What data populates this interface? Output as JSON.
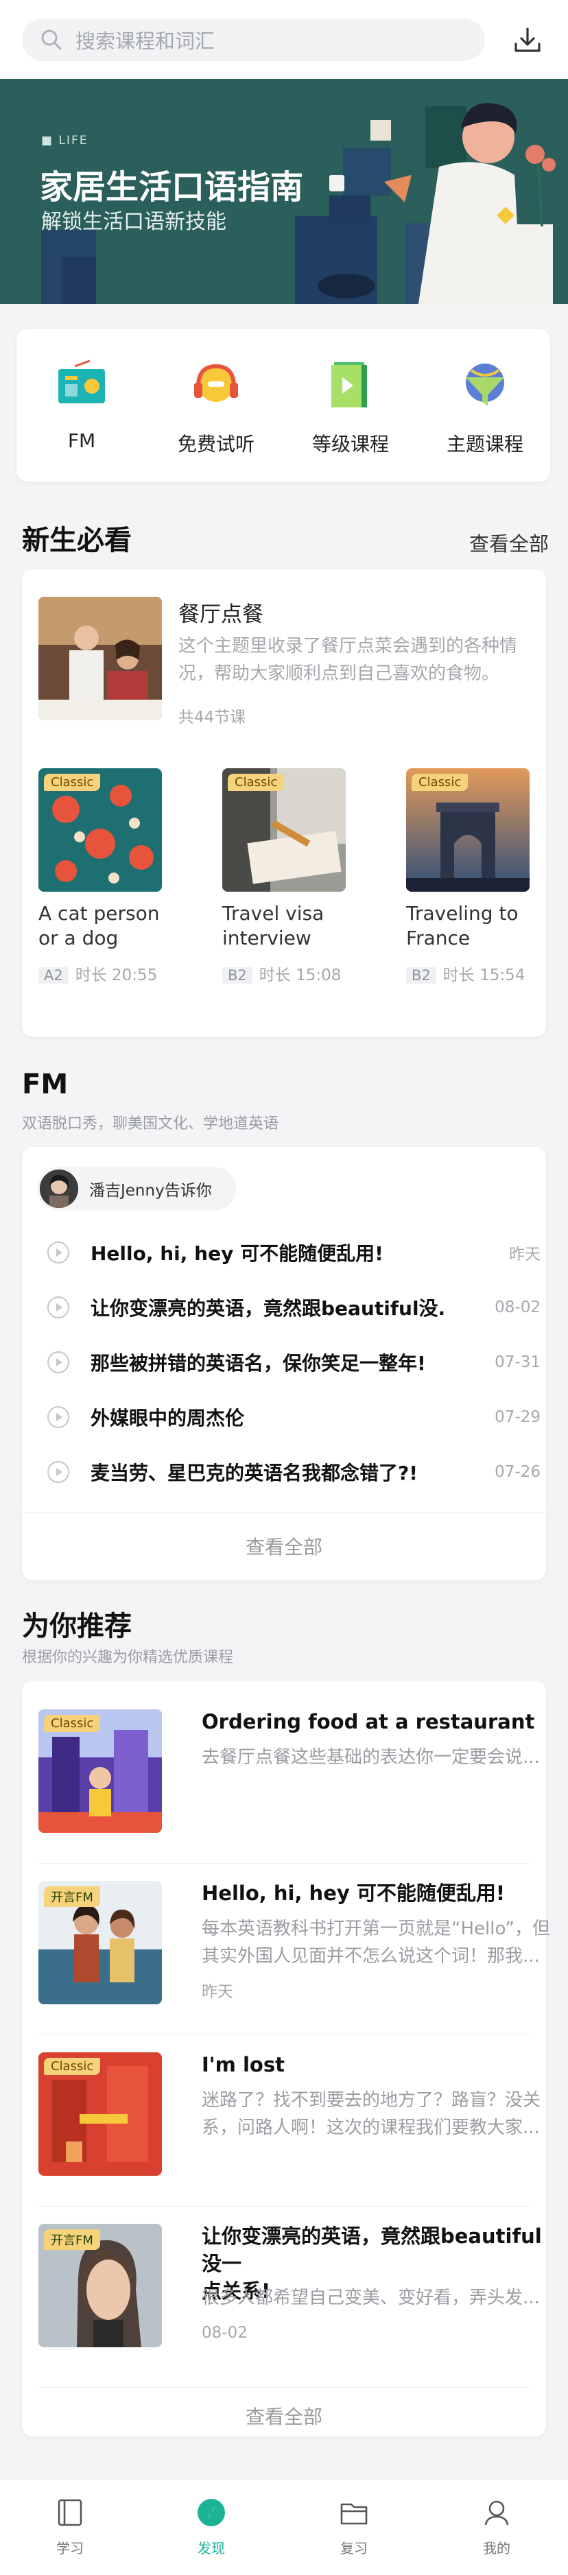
{
  "search": {
    "placeholder": "搜索课程和词汇"
  },
  "banner": {
    "label": "LIFE",
    "title": "家居生活口语指南",
    "subtitle": "解锁生活口语新技能",
    "slide_count": 3,
    "active_slide": 3
  },
  "quick": [
    {
      "label": "FM",
      "icon": "radio-icon"
    },
    {
      "label": "免费试听",
      "icon": "headphones-icon"
    },
    {
      "label": "等级课程",
      "icon": "play-book-icon"
    },
    {
      "label": "主题课程",
      "icon": "globe-funnel-icon"
    }
  ],
  "newbie": {
    "title": "新生必看",
    "more": "查看全部",
    "featured": {
      "title": "餐厅点餐",
      "desc": "这个主题里收录了餐厅点菜会遇到的各种情况，帮助大家顺利点到自己喜欢的食物。",
      "count": "共44节课"
    },
    "courses": [
      {
        "tag": "Classic",
        "title_line1": "A cat person",
        "title_line2": "or a dog",
        "level": "A2",
        "duration": "时长 20:55"
      },
      {
        "tag": "Classic",
        "title_line1": "Travel visa",
        "title_line2": "interview",
        "level": "B2",
        "duration": "时长 15:08"
      },
      {
        "tag": "Classic",
        "title_line1": "Traveling to",
        "title_line2": "France",
        "level": "B2",
        "duration": "时长 15:54"
      }
    ]
  },
  "fm": {
    "title": "FM",
    "subtitle": "双语脱口秀，聊美国文化、学地道英语",
    "host": "潘吉Jenny告诉你",
    "items": [
      {
        "title": "Hello, hi, hey 可不能随便乱用!",
        "date": "昨天"
      },
      {
        "title": "让你变漂亮的英语，竟然跟beautiful没...",
        "date": "08-02"
      },
      {
        "title": "那些被拼错的英语名，保你笑足一整年!",
        "date": "07-31"
      },
      {
        "title": "外媒眼中的周杰伦",
        "date": "07-29"
      },
      {
        "title": "麦当劳、星巴克的英语名我都念错了?!",
        "date": "07-26"
      }
    ],
    "see_all": "查看全部"
  },
  "rec": {
    "title": "为你推荐",
    "subtitle": "根据你的兴趣为你精选优质课程",
    "items": [
      {
        "tag": "Classic",
        "title": "Ordering food at a restaurant",
        "desc": "去餐厅点餐这些基础的表达你一定要会说...",
        "date": ""
      },
      {
        "tag": "开言FM",
        "title": "Hello, hi, hey 可不能随便乱用!",
        "desc_line1": "每本英语教科书打开第一页就是“Hello”，但",
        "desc_line2": "其实外国人见面并不怎么说这个词！那我...",
        "date": "昨天"
      },
      {
        "tag": "Classic",
        "title": "I'm lost",
        "desc_line1": "迷路了？找不到要去的地方了？路盲？没关",
        "desc_line2": "系，问路人啊！这次的课程我们要教大家...",
        "date": ""
      },
      {
        "tag": "开言FM",
        "title_line1": "让你变漂亮的英语，竟然跟beautiful没一",
        "title_line2": "点关系!",
        "desc": "很多人都希望自己变美、变好看，弄头发...",
        "date": "08-02"
      }
    ],
    "see_all": "查看全部"
  },
  "tabs": [
    {
      "label": "学习",
      "icon": "book-icon"
    },
    {
      "label": "发现",
      "icon": "compass-icon",
      "active": true
    },
    {
      "label": "复习",
      "icon": "folder-icon"
    },
    {
      "label": "我的",
      "icon": "user-icon"
    }
  ],
  "colors": {
    "accent": "#1ab394",
    "banner_bg": "#2b5f5b",
    "tag_bg": "#f6d37b",
    "dot_active": "#f6c83a"
  }
}
